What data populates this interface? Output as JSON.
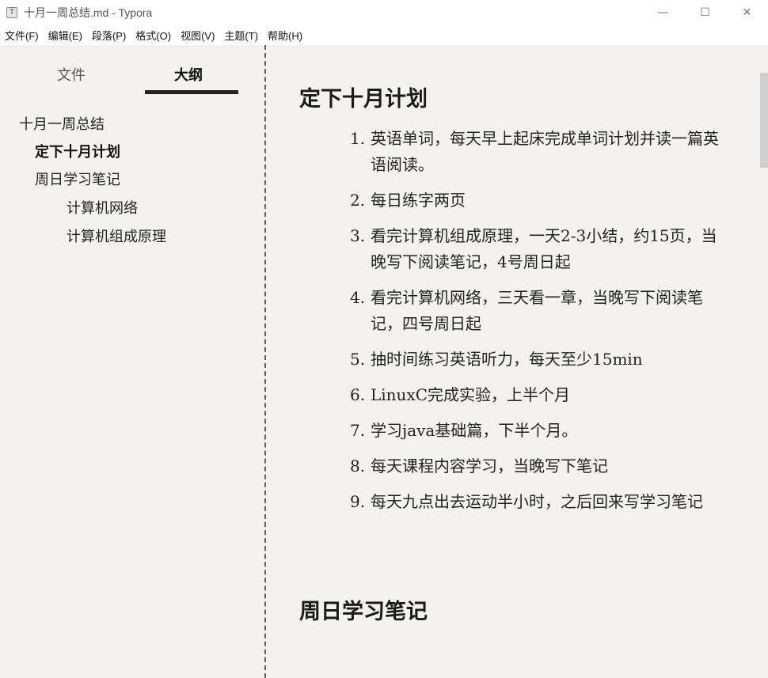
{
  "window": {
    "icon_letter": "T",
    "title": "十月一周总结.md - Typora",
    "minimize": "—",
    "maximize": "☐",
    "close": "✕"
  },
  "menu": {
    "items": [
      "文件(F)",
      "编辑(E)",
      "段落(P)",
      "格式(O)",
      "视图(V)",
      "主题(T)",
      "帮助(H)"
    ]
  },
  "sidebar": {
    "tabs": {
      "files": "文件",
      "outline": "大纲",
      "active": "outline"
    },
    "outline": [
      {
        "label": "十月一周总结",
        "level": 1
      },
      {
        "label": "定下十月计划",
        "level": 2,
        "active": true
      },
      {
        "label": "周日学习笔记",
        "level": 2
      },
      {
        "label": "计算机网络",
        "level": 3
      },
      {
        "label": "计算机组成原理",
        "level": 3
      }
    ]
  },
  "editor": {
    "heading1": "定下十月计划",
    "list": [
      {
        "num": "1.",
        "text": "英语单词，每天早上起床完成单词计划并读一篇英语阅读。"
      },
      {
        "num": "2.",
        "text": "每日练字两页"
      },
      {
        "num": "3.",
        "text": "看完计算机组成原理，一天2-3小结，约15页，当晚写下阅读笔记，4号周日起"
      },
      {
        "num": "4.",
        "text": "看完计算机网络，三天看一章，当晚写下阅读笔记，四号周日起"
      },
      {
        "num": "5.",
        "text": "抽时间练习英语听力，每天至少15min"
      },
      {
        "num": "6.",
        "text": "LinuxC完成实验，上半个月"
      },
      {
        "num": "7.",
        "text": "学习java基础篇，下半个月。"
      },
      {
        "num": "8.",
        "text": "每天课程内容学习，当晚写下笔记"
      },
      {
        "num": "9.",
        "text": "每天九点出去运动半小时，之后回来写学习笔记"
      }
    ],
    "heading2": "周日学习笔记"
  }
}
